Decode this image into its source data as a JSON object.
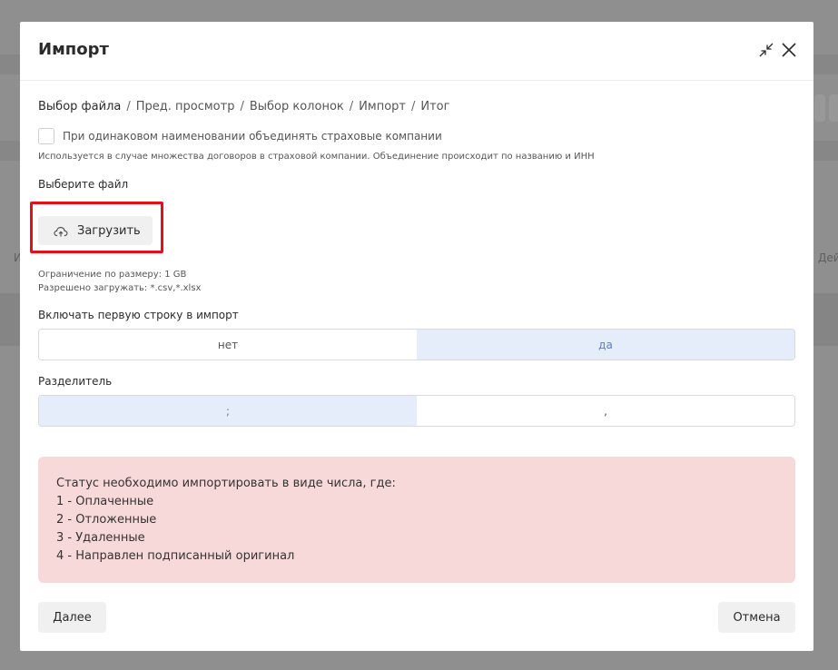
{
  "modal": {
    "title": "Импорт",
    "icons": {
      "collapse": "collapse-arrows-icon",
      "close": "close-icon"
    }
  },
  "breadcrumb": [
    {
      "label": "Выбор файла",
      "active": true
    },
    {
      "label": "Пред. просмотр",
      "active": false
    },
    {
      "label": "Выбор колонок",
      "active": false
    },
    {
      "label": "Импорт",
      "active": false
    },
    {
      "label": "Итог",
      "active": false
    }
  ],
  "breadcrumb_separator": "/",
  "merge_option": {
    "label": "При одинаковом наименовании объединять страховые компании",
    "checked": false,
    "hint": "Используется в случае множества договоров в страховой компании. Объединение происходит по названию и ИНН"
  },
  "file": {
    "label": "Выберите файл",
    "upload_button": "Загрузить",
    "upload_icon": "cloud-upload-icon",
    "size_limit": "Ограничение по размеру: 1 GB",
    "allowed_types": "Разрешено загружать: *.csv,*.xlsx"
  },
  "include_first_row": {
    "label": "Включать первую строку в импорт",
    "options": [
      "нет",
      "да"
    ],
    "selected": "да"
  },
  "separator": {
    "label": "Разделитель",
    "options": [
      ";",
      ","
    ],
    "selected": ";"
  },
  "alert": {
    "lines": [
      "Статус необходимо импортировать в виде числа, где:",
      "1 - Оплаченные",
      "2 - Отложенные",
      "3 - Удаленные",
      "4 - Направлен подписанный оригинал"
    ],
    "background": "#f7d9d9"
  },
  "footer": {
    "next": "Далее",
    "cancel": "Отмена"
  },
  "background_app": {
    "left_edge_text": "И",
    "right_edge_text": "Дей"
  },
  "colors": {
    "highlight_border": "#e3101a",
    "segment_selected_bg": "#e5edfb",
    "segment_selected_text": "#5b7fc4"
  }
}
